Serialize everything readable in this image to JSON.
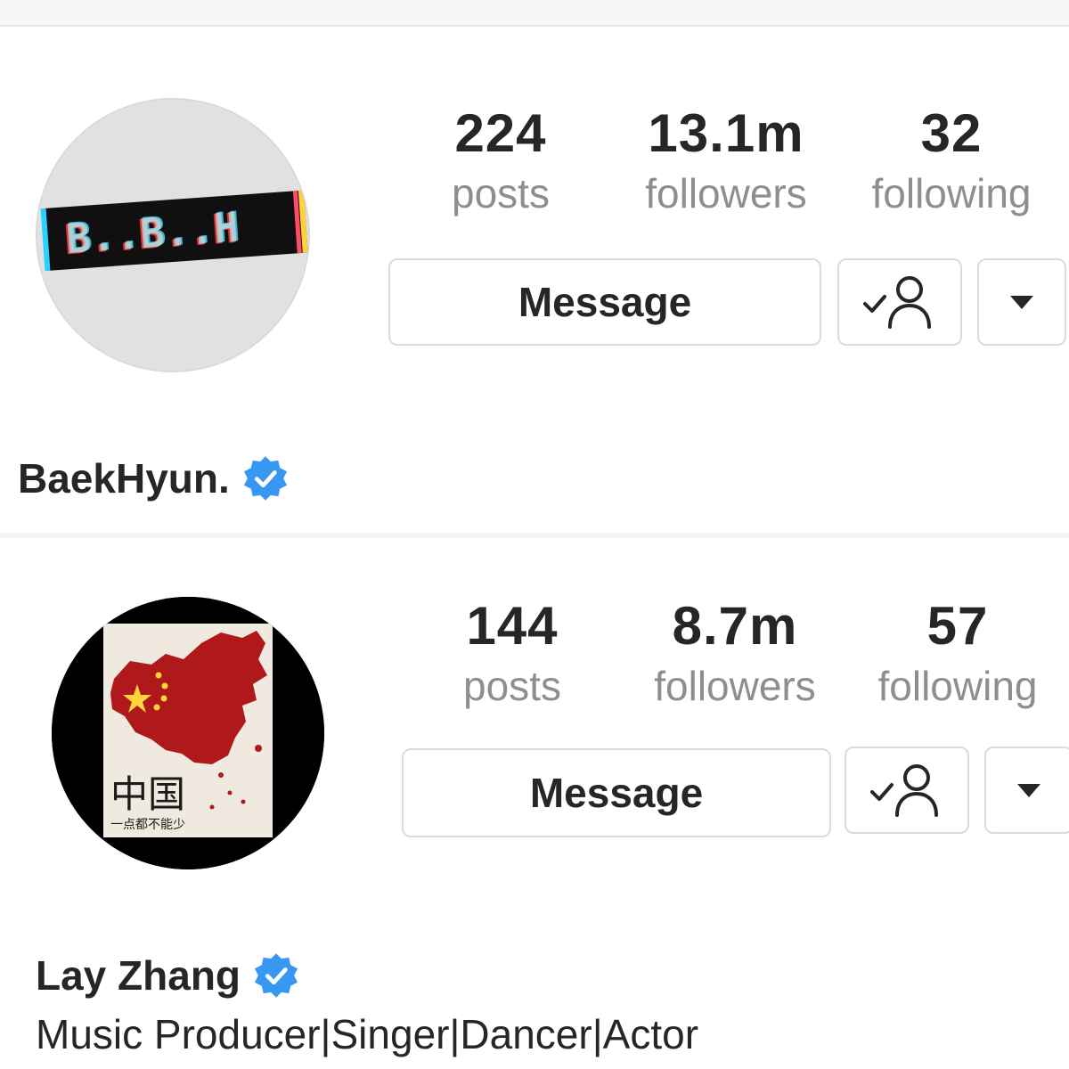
{
  "colors": {
    "verified": "#3897f0",
    "stat_number": "#262626",
    "stat_label": "#8e8e8e",
    "button_border": "#dbdbdb"
  },
  "profiles": [
    {
      "name": "BaekHyun.",
      "verified": true,
      "avatar": {
        "text": "B..B..H"
      },
      "stats": {
        "posts": {
          "value": "224",
          "label": "posts"
        },
        "followers": {
          "value": "13.1m",
          "label": "followers"
        },
        "following": {
          "value": "32",
          "label": "following"
        }
      },
      "buttons": {
        "message": "Message",
        "follow_icon": "following-check-icon",
        "more_icon": "caret-down-icon"
      }
    },
    {
      "name": "Lay Zhang",
      "verified": true,
      "avatar": {
        "text": "中国",
        "caption": "一点都不能少"
      },
      "bio": "Music Producer|Singer|Dancer|Actor",
      "stats": {
        "posts": {
          "value": "144",
          "label": "posts"
        },
        "followers": {
          "value": "8.7m",
          "label": "followers"
        },
        "following": {
          "value": "57",
          "label": "following"
        }
      },
      "buttons": {
        "message": "Message",
        "follow_icon": "following-check-icon",
        "more_icon": "caret-down-icon"
      }
    }
  ]
}
